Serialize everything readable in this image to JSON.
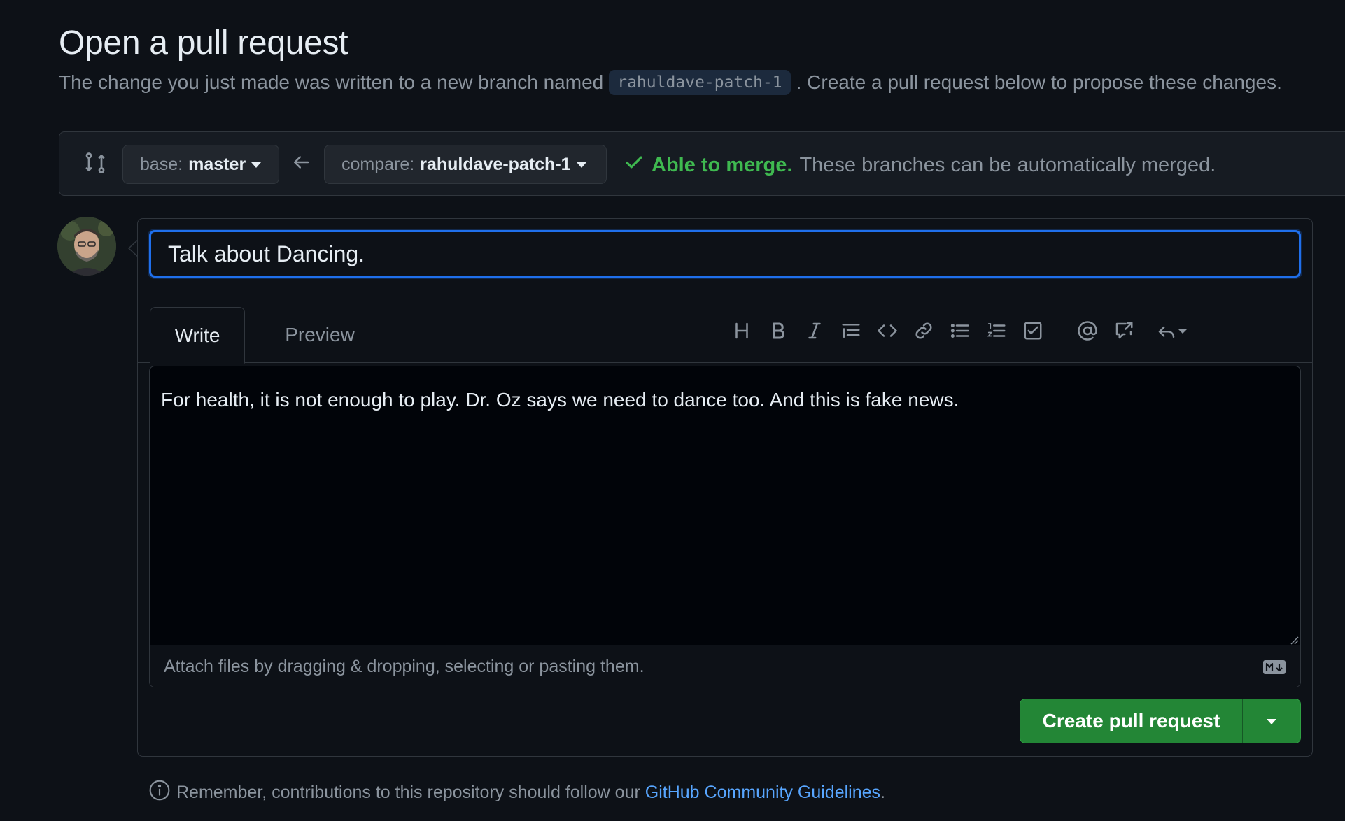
{
  "header": {
    "title": "Open a pull request",
    "subtitle_before": "The change you just made was written to a new branch named",
    "branch_name": "rahuldave-patch-1",
    "subtitle_after": ". Create a pull request below to propose these changes."
  },
  "compare": {
    "base_prefix": "base:",
    "base_branch": "master",
    "compare_prefix": "compare:",
    "compare_branch": "rahuldave-patch-1",
    "merge_ok": "Able to merge.",
    "merge_msg": "These branches can be automatically merged."
  },
  "editor": {
    "title_value": "Talk about Dancing.",
    "tabs": [
      "Write",
      "Preview"
    ],
    "body_text": "For health, it is not enough to play. Dr. Oz says we need to dance too. And this is fake news.",
    "attach_hint": "Attach files by dragging & dropping, selecting or pasting them.",
    "toolbar_icons": [
      "heading-icon",
      "bold-icon",
      "italic-icon",
      "quote-icon",
      "code-icon",
      "link-icon",
      "bulleted-list-icon",
      "numbered-list-icon",
      "task-list-icon",
      "mention-icon",
      "cross-reference-icon",
      "reply-icon"
    ]
  },
  "actions": {
    "create_label": "Create pull request"
  },
  "footer": {
    "note": "Remember, contributions to this repository should follow our",
    "link": "GitHub Community Guidelines",
    "period": "."
  },
  "colors": {
    "background": "#0d1117",
    "accent_blue": "#1f6feb",
    "success_green": "#3fb950",
    "button_green": "#238636",
    "link_blue": "#58a6ff"
  }
}
